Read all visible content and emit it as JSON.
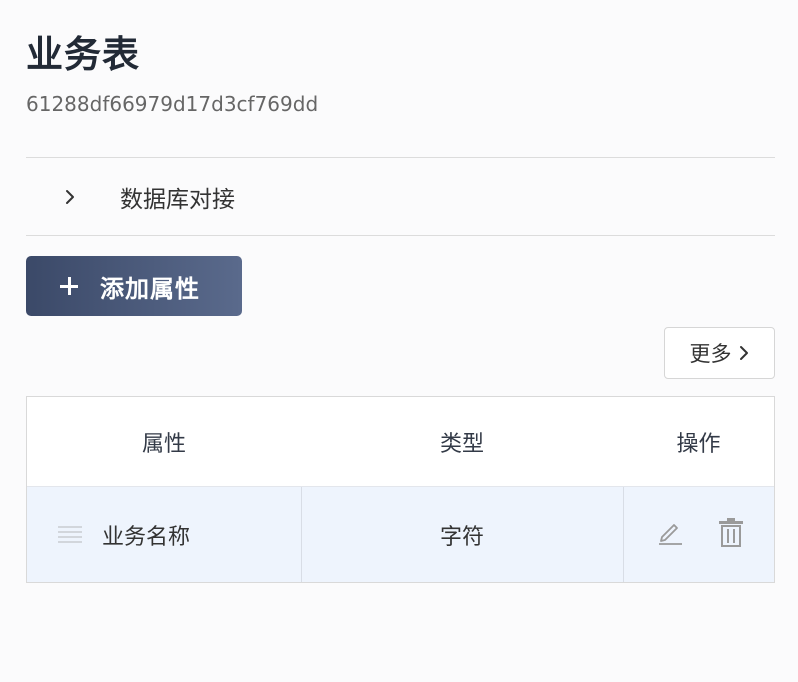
{
  "page": {
    "title": "业务表",
    "table_id": "61288df66979d17d3cf769dd"
  },
  "collapse": {
    "label": "数据库对接",
    "icon": "chevron-right-icon"
  },
  "actions": {
    "add_label": "添加属性",
    "more_label": "更多"
  },
  "table": {
    "headers": [
      "属性",
      "类型",
      "操作"
    ],
    "rows": [
      {
        "name": "业务名称",
        "type": "字符"
      }
    ]
  },
  "colors": {
    "primary_gradient_start": "#3b4968",
    "primary_gradient_end": "#5a6a8c",
    "row_highlight": "#eef4fd",
    "icon_gray": "#9a9a9a"
  }
}
